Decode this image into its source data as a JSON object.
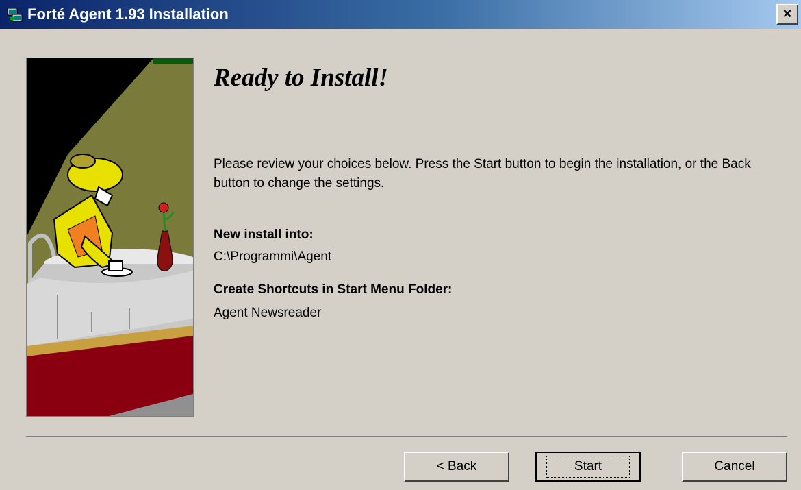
{
  "window": {
    "title": "Forté Agent 1.93 Installation",
    "close_glyph": "×"
  },
  "main": {
    "heading": "Ready to Install!",
    "intro": "Please review your choices below.  Press the Start button to begin the installation, or the Back button to change the settings.",
    "install_label": "New install into:",
    "install_path": "C:\\Programmi\\Agent",
    "shortcuts_label": "Create Shortcuts in Start Menu Folder:",
    "shortcuts_folder": "Agent Newsreader"
  },
  "buttons": {
    "back_prefix": "< ",
    "back_mnemonic": "B",
    "back_rest": "ack",
    "start_mnemonic": "S",
    "start_rest": "tart",
    "cancel": "Cancel"
  },
  "colors": {
    "titlebar_start": "#0a246a",
    "titlebar_end": "#a6caf0",
    "dialog_bg": "#d4d0c8"
  }
}
